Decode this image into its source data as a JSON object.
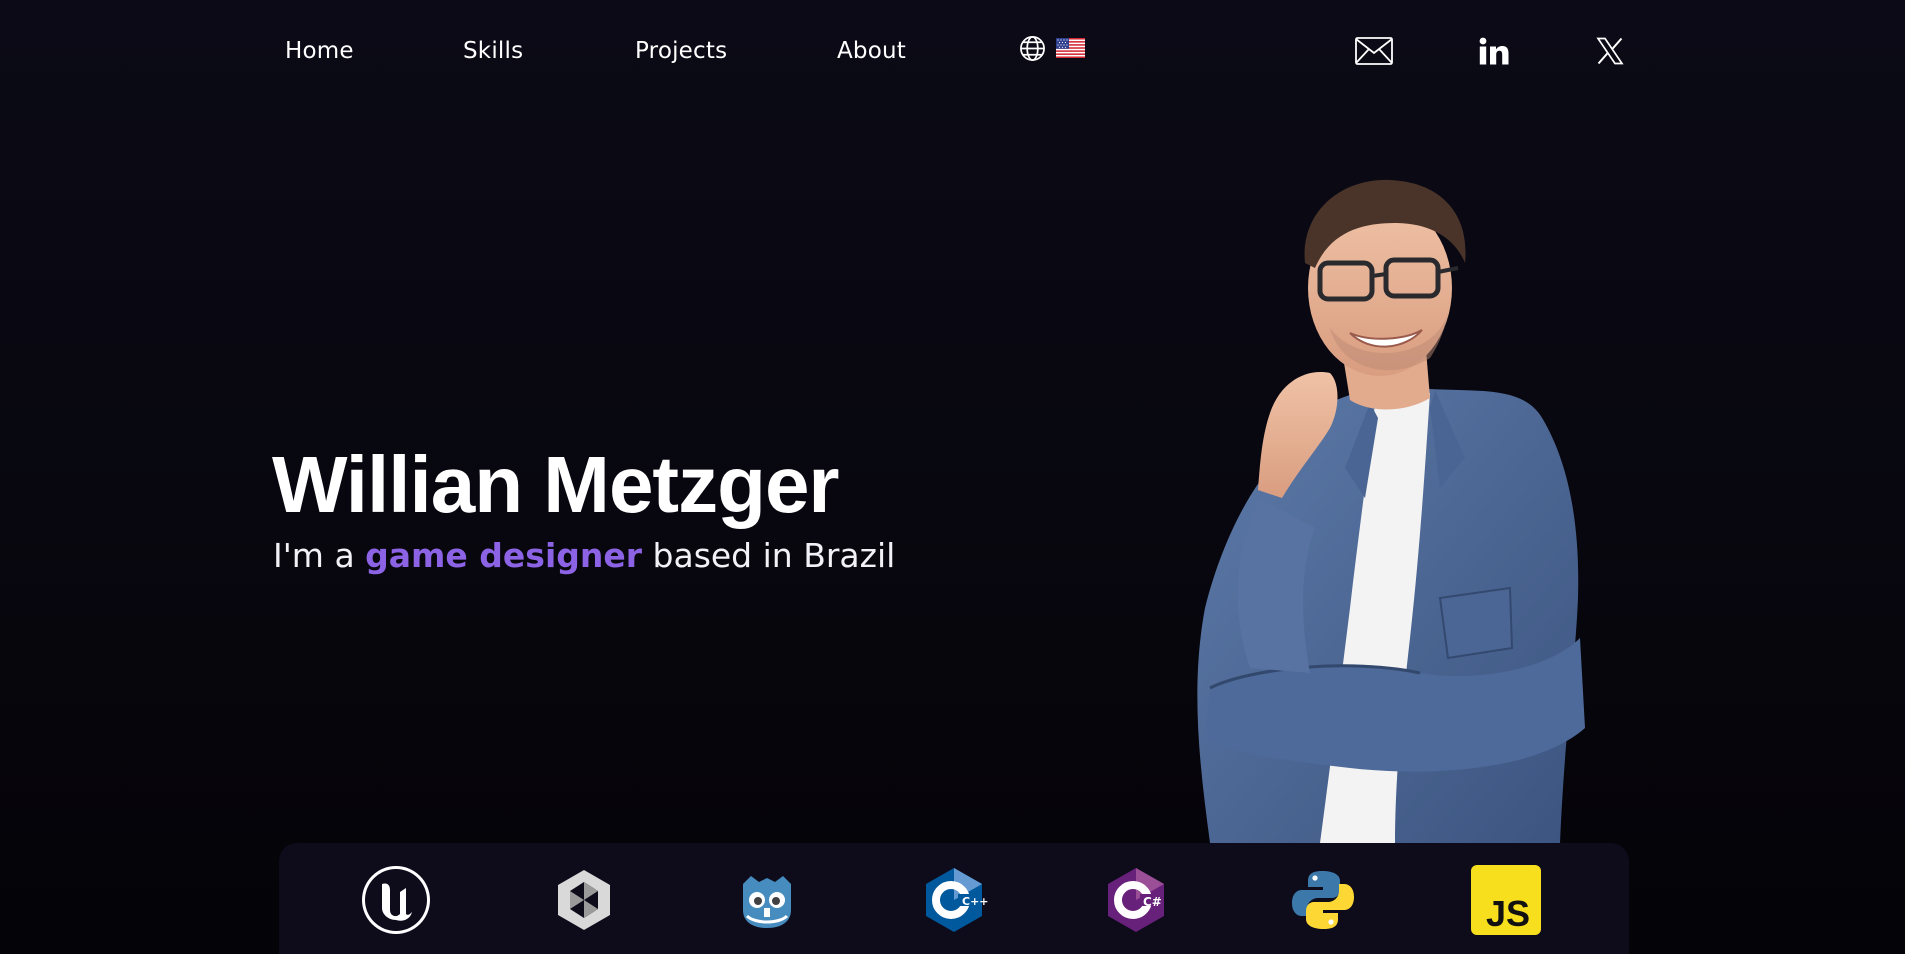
{
  "nav": {
    "links": [
      "Home",
      "Skills",
      "Projects",
      "About"
    ],
    "language": {
      "icon": "globe-icon",
      "flag": "us-flag-icon"
    },
    "social": [
      "mail-icon",
      "linkedin-icon",
      "x-icon"
    ]
  },
  "hero": {
    "name": "Willian Metzger",
    "tagline_prefix": "I'm a ",
    "tagline_highlight": "game designer",
    "tagline_suffix": " based in Brazil",
    "accent_color": "#8d63e6"
  },
  "skills": [
    "unreal-engine-icon",
    "unity-icon",
    "godot-icon",
    "cpp-icon",
    "csharp-icon",
    "python-icon",
    "javascript-icon"
  ],
  "skill_labels": {
    "cpp": "C++",
    "csharp": "C#",
    "javascript": "JS"
  }
}
